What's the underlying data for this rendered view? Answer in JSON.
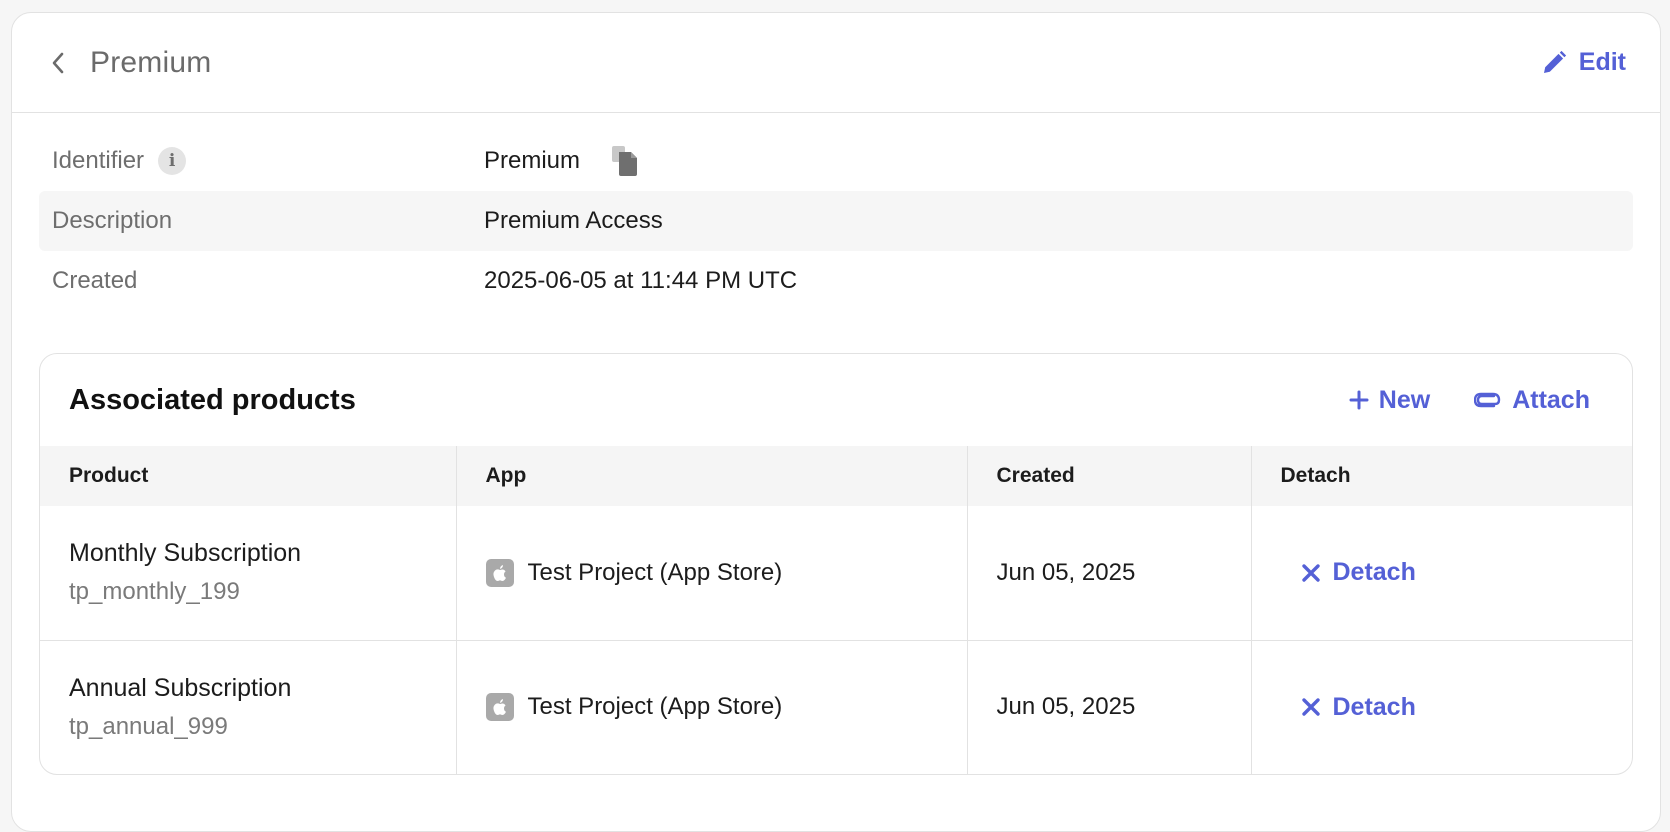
{
  "header": {
    "title": "Premium",
    "edit_label": "Edit"
  },
  "details": {
    "identifier_label": "Identifier",
    "identifier_value": "Premium",
    "description_label": "Description",
    "description_value": "Premium Access",
    "created_label": "Created",
    "created_value": "2025-06-05 at 11:44 PM UTC"
  },
  "products": {
    "title": "Associated products",
    "new_label": "New",
    "attach_label": "Attach",
    "columns": [
      "Product",
      "App",
      "Created",
      "Detach"
    ],
    "rows": [
      {
        "name": "Monthly Subscription",
        "id": "tp_monthly_199",
        "app": "Test Project (App Store)",
        "created": "Jun 05, 2025",
        "detach_label": "Detach"
      },
      {
        "name": "Annual Subscription",
        "id": "tp_annual_999",
        "app": "Test Project (App Store)",
        "created": "Jun 05, 2025",
        "detach_label": "Detach"
      }
    ]
  },
  "colors": {
    "accent": "#5460d6",
    "muted_text": "#6e6e6e",
    "border": "#e2e2e2",
    "row_shade": "#f6f6f6"
  },
  "icons": [
    "chevron-left-icon",
    "pencil-icon",
    "info-icon",
    "copy-icon",
    "plus-icon",
    "paperclip-icon",
    "apple-icon",
    "x-icon"
  ]
}
